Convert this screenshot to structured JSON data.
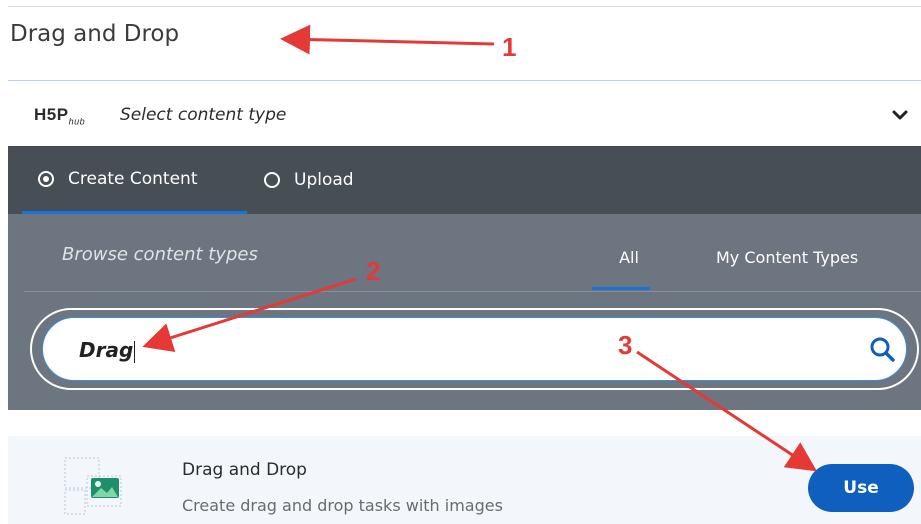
{
  "title_field": {
    "value": "Drag and Drop"
  },
  "hub": {
    "logo": "H5P",
    "logo_sub": "hub",
    "select_label": "Select content type"
  },
  "tabs": [
    {
      "label": "Create Content",
      "selected": true
    },
    {
      "label": "Upload",
      "selected": false
    }
  ],
  "browse": {
    "title": "Browse content types",
    "filter_all": "All",
    "filter_mine": "My Content Types"
  },
  "search": {
    "value": "Drag"
  },
  "result": {
    "title": "Drag and Drop",
    "description": "Create drag and drop tasks with images",
    "use_label": "Use"
  },
  "annotations": {
    "n1": "1",
    "n2": "2",
    "n3": "3"
  },
  "colors": {
    "accent": "#0f5fbf",
    "annotation": "#e53935",
    "tabbar": "#474e56",
    "browse_bg": "#6c7580"
  }
}
